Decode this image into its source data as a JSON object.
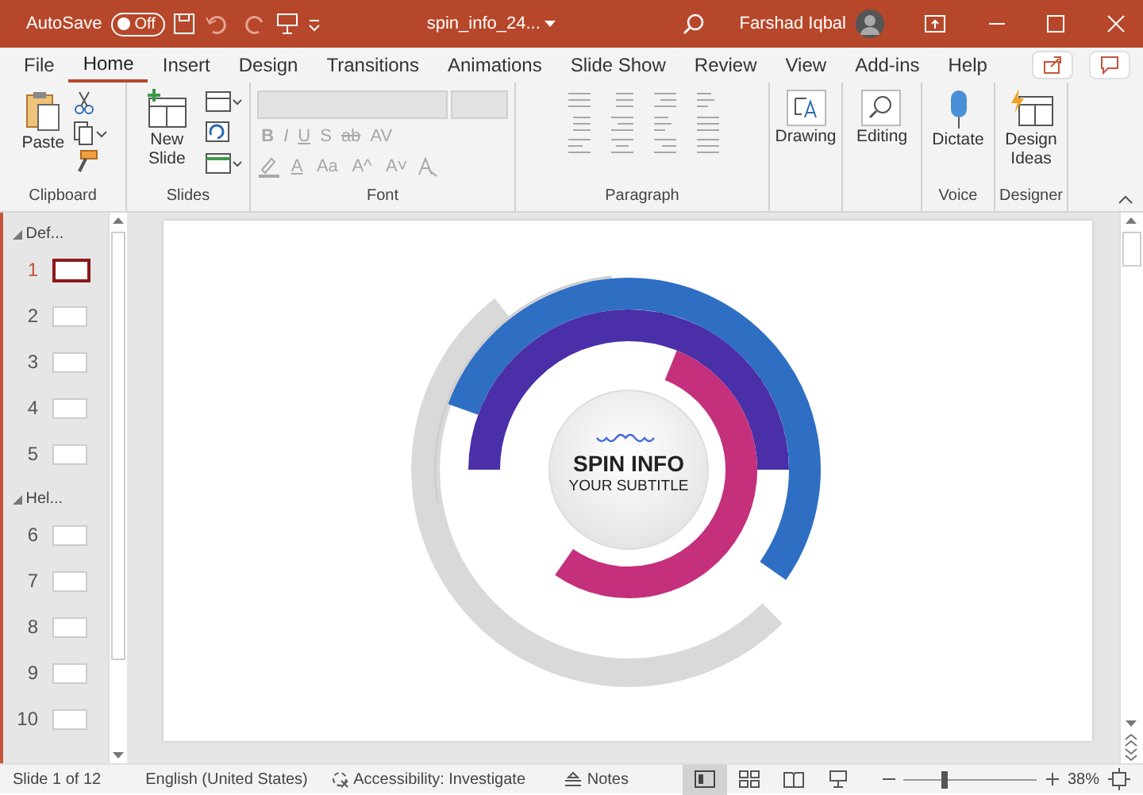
{
  "title_bar": {
    "autosave_label": "AutoSave",
    "autosave_toggle": {
      "label": "Off",
      "on": false
    },
    "file_name": "spin_info_24...",
    "user_name": "Farshad Iqbal"
  },
  "tabs": [
    {
      "label": "File",
      "selected": false
    },
    {
      "label": "Home",
      "selected": true
    },
    {
      "label": "Insert",
      "selected": false
    },
    {
      "label": "Design",
      "selected": false
    },
    {
      "label": "Transitions",
      "selected": false
    },
    {
      "label": "Animations",
      "selected": false
    },
    {
      "label": "Slide Show",
      "selected": false
    },
    {
      "label": "Review",
      "selected": false
    },
    {
      "label": "View",
      "selected": false
    },
    {
      "label": "Add-ins",
      "selected": false
    },
    {
      "label": "Help",
      "selected": false
    }
  ],
  "ribbon": {
    "clipboard": {
      "label": "Clipboard",
      "paste": "Paste"
    },
    "slides": {
      "label": "Slides",
      "new_slide": "New Slide"
    },
    "font": {
      "label": "Font",
      "disabled": true,
      "row_1": [
        "B",
        "I",
        "U",
        "S",
        "ab",
        "AV"
      ],
      "row_2": [
        "A",
        "Aa",
        "A^",
        "A˅"
      ]
    },
    "paragraph": {
      "label": "Paragraph",
      "disabled": true
    },
    "drawing": {
      "button": "Drawing"
    },
    "editing": {
      "button": "Editing"
    },
    "voice": {
      "label": "Voice",
      "button": "Dictate"
    },
    "designer": {
      "label": "Designer",
      "button": "Design Ideas"
    }
  },
  "slide_panel": {
    "sections": [
      {
        "label": "Def...",
        "expanded": true,
        "slides": [
          {
            "number": "1",
            "selected": true
          },
          {
            "number": "2",
            "selected": false
          },
          {
            "number": "3",
            "selected": false
          },
          {
            "number": "4",
            "selected": false
          },
          {
            "number": "5",
            "selected": false
          }
        ]
      },
      {
        "label": "Hel...",
        "expanded": true,
        "slides": [
          {
            "number": "6",
            "selected": false
          },
          {
            "number": "7",
            "selected": false
          },
          {
            "number": "8",
            "selected": false
          },
          {
            "number": "9",
            "selected": false
          },
          {
            "number": "10",
            "selected": false
          }
        ]
      }
    ]
  },
  "slide": {
    "title": "SPIN INFO",
    "subtitle": "YOUR SUBTITLE"
  },
  "status_bar": {
    "slide_count": "Slide 1 of 12",
    "language": "English (United States)",
    "accessibility": "Accessibility: Investigate",
    "notes": "Notes",
    "views": [
      {
        "kind": "normal",
        "selected": true
      },
      {
        "kind": "sorter",
        "selected": false
      },
      {
        "kind": "reading",
        "selected": false
      },
      {
        "kind": "slideshow",
        "selected": false
      }
    ],
    "zoom": {
      "level": 0.3,
      "reading": "38%"
    }
  }
}
